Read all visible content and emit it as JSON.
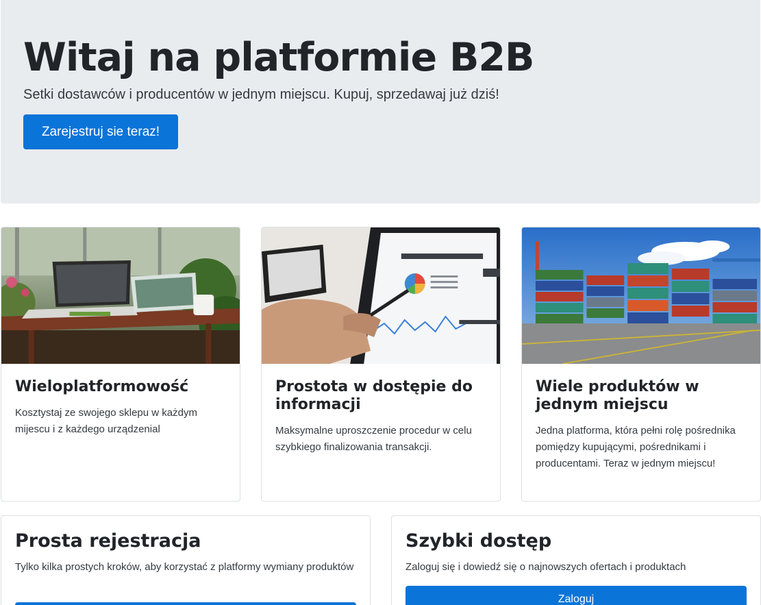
{
  "hero": {
    "title": "Witaj na platformie B2B",
    "lead": "Setki dostawców i producentów w jednym miejscu. Kupuj, sprzedawaj już dziś!",
    "register_button": "Zarejestruj sie teraz!"
  },
  "features": [
    {
      "image": "laptop-table-photo",
      "title": "Wieloplatformowość",
      "text": "Kosztystaj ze swojego sklepu w każdym mijescu i z każdego urządzenial"
    },
    {
      "image": "tablet-analytics-photo",
      "title": "Prostota w dostępie do informacji",
      "text": "Maksymalne uproszczenie procedur w celu szybkiego finalizowania transakcji."
    },
    {
      "image": "shipping-containers-photo",
      "title": "Wiele produktów w jednym miejscu",
      "text": "Jedna platforma, która pełni rolę pośrednika pomiędzy kupującymi, pośrednikami i producentami. Teraz w jednym miejscu!"
    }
  ],
  "bottom": [
    {
      "title": "Prosta rejestracja",
      "text": "Tylko kilka prostych kroków, aby korzystać z platformy wymiany produktów",
      "button": ""
    },
    {
      "title": "Szybki dostęp",
      "text": "Zaloguj się i dowiedź się o najnowszych ofertach i produktach",
      "button": "Zaloguj"
    }
  ],
  "colors": {
    "primary": "#0a74d9",
    "jumbotron_bg": "#e9ecef",
    "text": "#212529"
  }
}
